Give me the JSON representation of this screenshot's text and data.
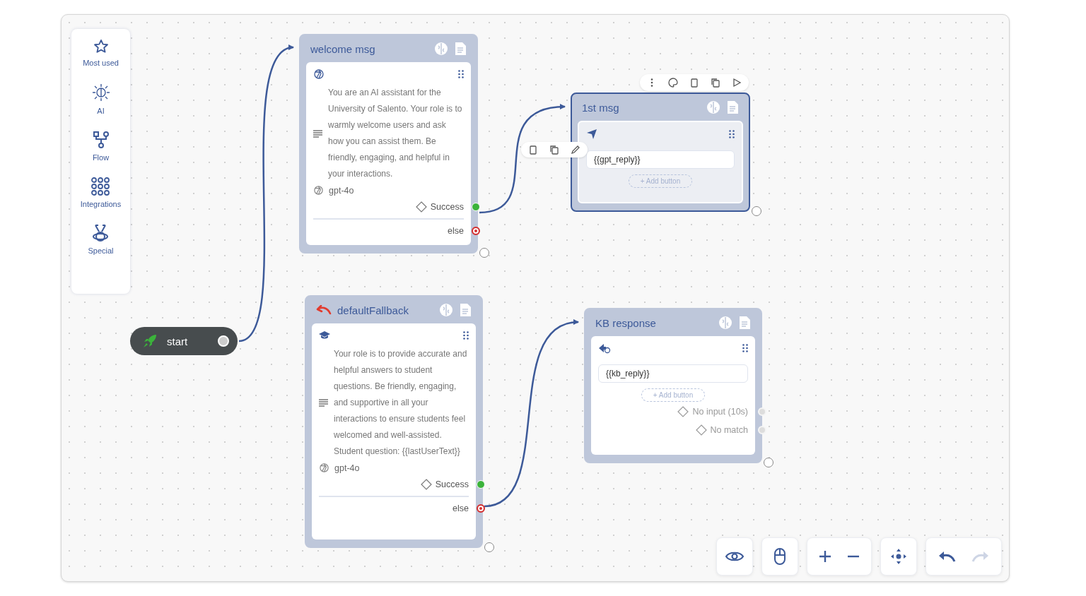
{
  "sidebar": {
    "items": [
      {
        "label": "Most used"
      },
      {
        "label": "AI"
      },
      {
        "label": "Flow"
      },
      {
        "label": "Integrations"
      },
      {
        "label": "Special"
      }
    ]
  },
  "start": {
    "label": "start"
  },
  "nodes": [
    {
      "kind": "ai",
      "title": "welcome msg",
      "selected": false,
      "fallback": false,
      "prompt": "You are an AI assistant for the University of Salento. Your role is to warmly welcome users and ask how you can assist them. Be friendly, engaging, and helpful in your interactions.",
      "model": "gpt-4o",
      "success": "Success",
      "else": "else"
    },
    {
      "kind": "message",
      "title": "1st msg",
      "selected": true,
      "fallback": false,
      "reply": "{{gpt_reply}}",
      "add_button": "+ Add button"
    },
    {
      "kind": "ai",
      "title": "defaultFallback",
      "selected": false,
      "fallback": true,
      "prompt": "Your role is to provide accurate and helpful answers to student questions. Be friendly, engaging, and supportive in all your interactions to ensure students feel welcomed and well-assisted. Student question: {{lastUserText}}",
      "model": "gpt-4o",
      "success": "Success",
      "else": "else"
    },
    {
      "kind": "message",
      "title": "KB response",
      "selected": false,
      "fallback": false,
      "reply": "{{kb_reply}}",
      "add_button": "+ Add button",
      "conditions": [
        "No input (10s)",
        "No match"
      ]
    }
  ],
  "controls": {
    "redo_disabled": true
  }
}
